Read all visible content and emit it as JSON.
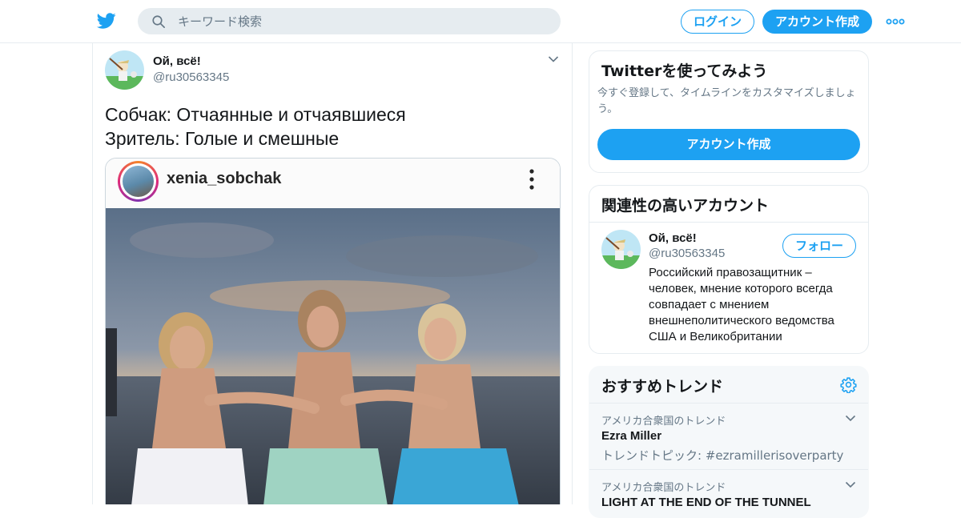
{
  "colors": {
    "accent": "#1da1f2",
    "text": "#14171a",
    "muted": "#657786",
    "border": "#e6ecf0",
    "search_bg": "#e6ecf0"
  },
  "header": {
    "logo_icon": "twitter-bird-icon",
    "search": {
      "placeholder": "キーワード検索",
      "value": "",
      "icon": "search-icon"
    },
    "login_label": "ログイン",
    "signup_label": "アカウント作成",
    "more_icon": "more-dots-icon"
  },
  "tweet": {
    "author_name": "Ой, всё!",
    "author_handle": "@ru30563345",
    "text": "Собчак: Отчаянные и отчаявшиеся\nЗритель: Голые и смешные",
    "menu_icon": "chevron-down-icon",
    "media": {
      "ig_username": "xenia_sobchak",
      "menu_icon": "vertical-dots-icon"
    }
  },
  "signup_card": {
    "title": "Twitterを使ってみよう",
    "description": "今すぐ登録して、タイムラインをカスタマイズしましょう。",
    "button_label": "アカウント作成"
  },
  "relevant_accounts": {
    "title": "関連性の高いアカウント",
    "accounts": [
      {
        "name": "Ой, всё!",
        "handle": "@ru30563345",
        "follow_label": "フォロー",
        "bio": "Российский правозащитник – человек, мнение которого всегда совпадает с мнением внешнеполитического ведомства США и Великобритании"
      }
    ]
  },
  "trends": {
    "title": "おすすめトレンド",
    "settings_icon": "gear-icon",
    "items": [
      {
        "meta": "アメリカ合衆国のトレンド",
        "name": "Ezra Miller",
        "sub": "トレンドトピック: #ezramillerisoverparty"
      },
      {
        "meta": "アメリカ合衆国のトレンド",
        "name": "LIGHT AT THE END OF THE TUNNEL",
        "sub": ""
      }
    ]
  }
}
